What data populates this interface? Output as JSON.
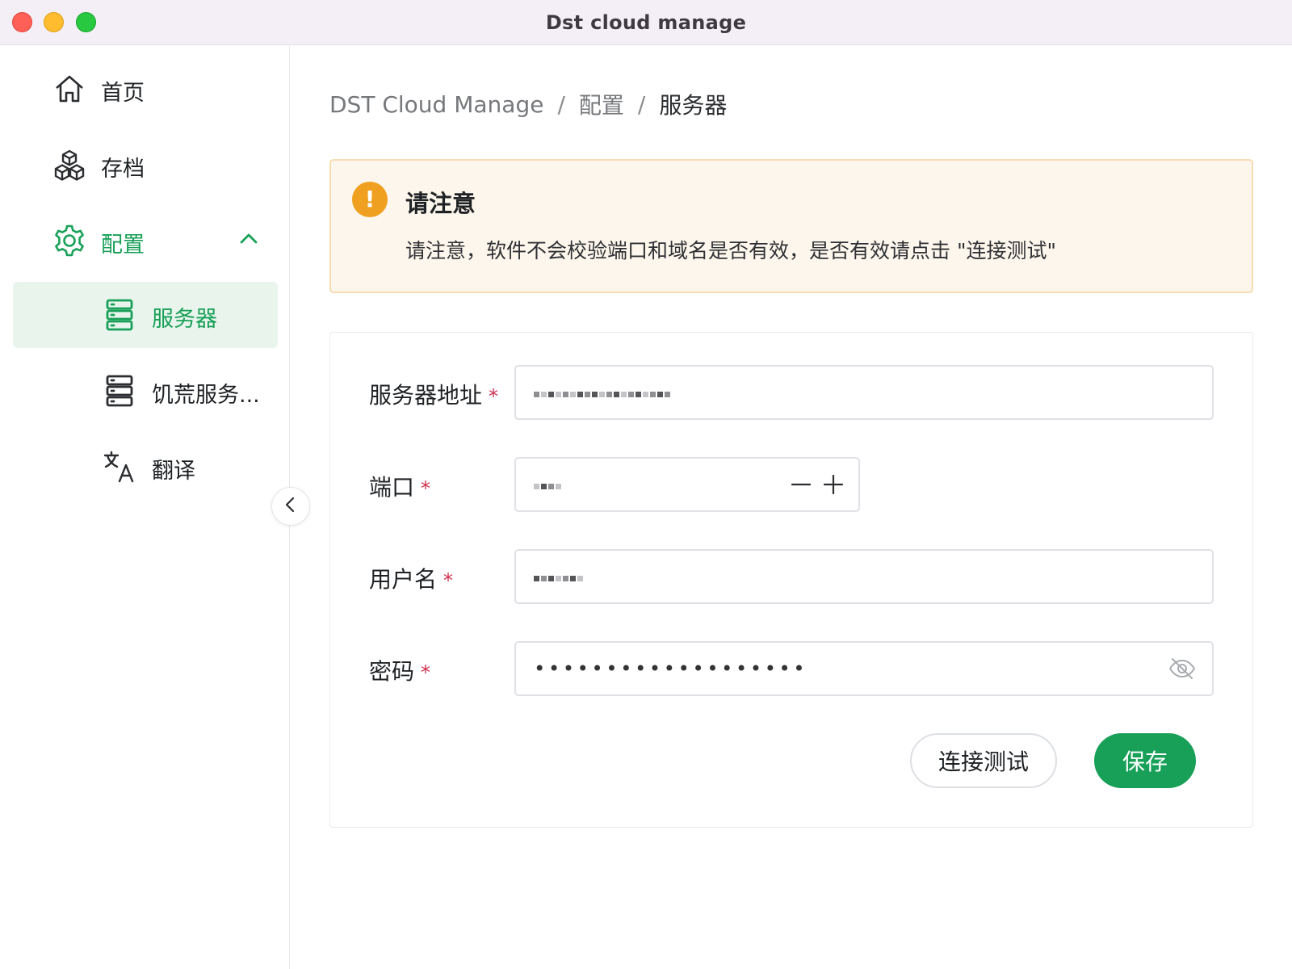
{
  "window": {
    "title": "Dst cloud manage"
  },
  "sidebar": {
    "items": [
      {
        "label": "首页",
        "icon": "home-icon"
      },
      {
        "label": "存档",
        "icon": "cubes-icon"
      },
      {
        "label": "配置",
        "icon": "gear-icon",
        "expanded": true
      },
      {
        "label": "服务器",
        "icon": "server-icon",
        "active": true
      },
      {
        "label": "饥荒服务...",
        "icon": "server-icon"
      },
      {
        "label": "翻译",
        "icon": "translate-icon"
      }
    ]
  },
  "breadcrumb": {
    "items": [
      "DST Cloud Manage",
      "配置",
      "服务器"
    ],
    "separator": "/"
  },
  "alert": {
    "title": "请注意",
    "body": "请注意，软件不会校验端口和域名是否有效，是否有效请点击 \"连接测试\"",
    "icon_text": "!"
  },
  "form": {
    "fields": [
      {
        "label": "服务器地址",
        "required_mark": "*"
      },
      {
        "label": "端口",
        "required_mark": "*"
      },
      {
        "label": "用户名",
        "required_mark": "*"
      },
      {
        "label": "密码",
        "required_mark": "*",
        "masked_value": "•••••••••••••••••••"
      }
    ],
    "test_button": "连接测试",
    "save_button": "保存"
  },
  "colors": {
    "accent": "#18a058",
    "warning": "#f0a020",
    "alert_bg": "#fdf6ec",
    "required": "#d03050"
  }
}
